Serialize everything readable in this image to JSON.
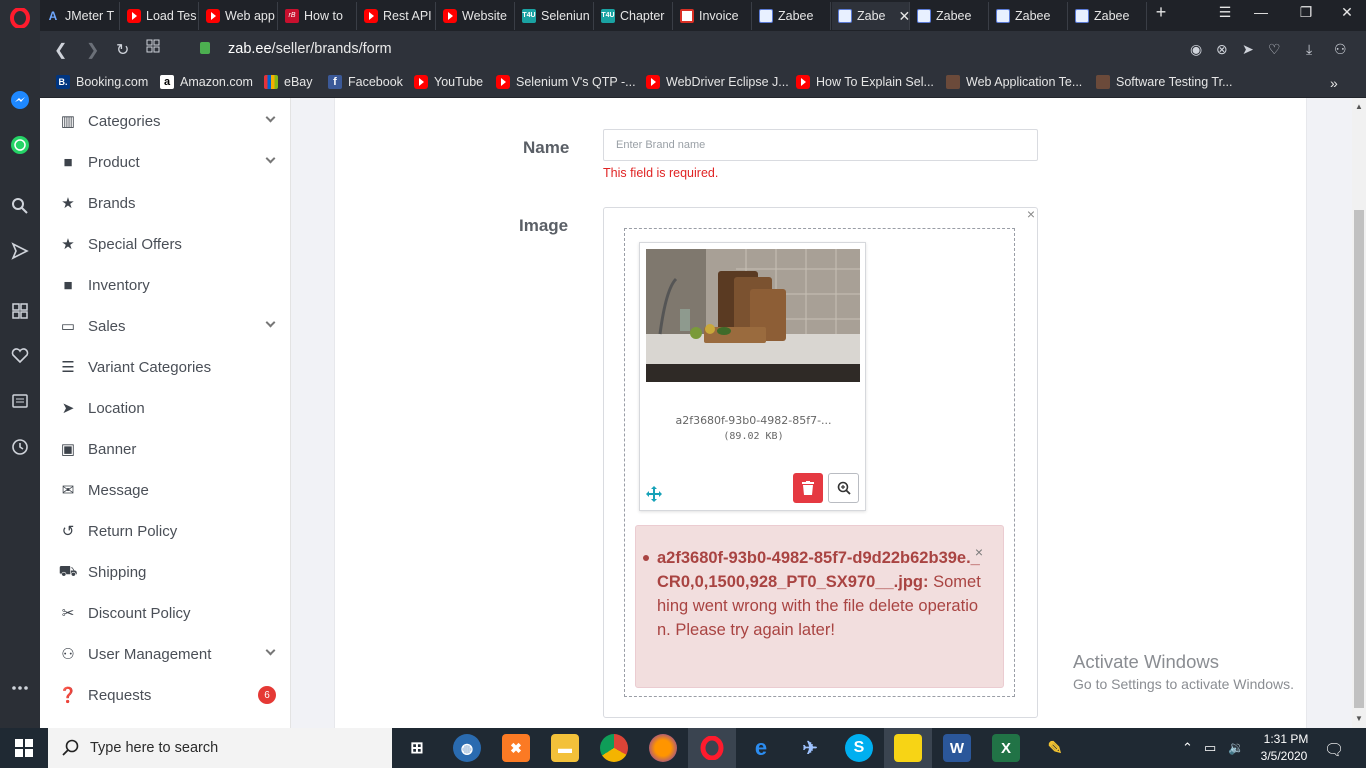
{
  "browser": {
    "tabs": [
      {
        "label": "JMeter T",
        "icon": "jmeter-icon"
      },
      {
        "label": "Load Tes",
        "icon": "youtube-icon"
      },
      {
        "label": "Web app",
        "icon": "youtube-icon"
      },
      {
        "label": "How to",
        "icon": "redbus-icon"
      },
      {
        "label": "Rest API",
        "icon": "youtube-icon"
      },
      {
        "label": "Website",
        "icon": "youtube-icon"
      },
      {
        "label": "Seleniun",
        "icon": "t4u-icon"
      },
      {
        "label": "Chapter",
        "icon": "t4u-icon"
      },
      {
        "label": "Invoice",
        "icon": "gmail-icon"
      },
      {
        "label": "Zabee",
        "icon": "zabee-icon"
      },
      {
        "label": "Zabe",
        "icon": "zabee-icon",
        "active": true
      },
      {
        "label": "Zabee",
        "icon": "zabee-icon"
      },
      {
        "label": "Zabee",
        "icon": "zabee-icon"
      },
      {
        "label": "Zabee",
        "icon": "zabee-icon"
      }
    ],
    "url_host": "zab.ee",
    "url_path": "/seller/brands/form",
    "t4u_text": "T4U",
    "redbus_text": "rB",
    "jmeter_text": "A",
    "bookmarks": [
      {
        "label": "Booking.com",
        "icon": "booking-icon"
      },
      {
        "label": "Amazon.com",
        "icon": "amazon-icon"
      },
      {
        "label": "eBay",
        "icon": "ebay-icon"
      },
      {
        "label": "Facebook",
        "icon": "facebook-icon"
      },
      {
        "label": "YouTube",
        "icon": "youtube-icon"
      },
      {
        "label": "Selenium V's QTP -...",
        "icon": "youtube-icon"
      },
      {
        "label": "WebDriver Eclipse J...",
        "icon": "youtube-icon"
      },
      {
        "label": "How To Explain Sel...",
        "icon": "youtube-icon"
      },
      {
        "label": "Web Application Te...",
        "icon": "cube-icon"
      },
      {
        "label": "Software Testing Tr...",
        "icon": "cube-icon"
      }
    ],
    "booking_text": "B.",
    "amazon_text": "a",
    "facebook_text": "f"
  },
  "sidebar": {
    "items": [
      {
        "label": "Categories",
        "icon": "bar-chart-icon",
        "expandable": true
      },
      {
        "label": "Product",
        "icon": "briefcase-icon",
        "expandable": true
      },
      {
        "label": "Brands",
        "icon": "star-icon"
      },
      {
        "label": "Special Offers",
        "icon": "star-icon"
      },
      {
        "label": "Inventory",
        "icon": "briefcase-icon"
      },
      {
        "label": "Sales",
        "icon": "money-icon",
        "expandable": true
      },
      {
        "label": "Variant Categories",
        "icon": "list-icon"
      },
      {
        "label": "Location",
        "icon": "location-arrow-icon"
      },
      {
        "label": "Banner",
        "icon": "image-icon"
      },
      {
        "label": "Message",
        "icon": "envelope-icon"
      },
      {
        "label": "Return Policy",
        "icon": "undo-icon"
      },
      {
        "label": "Shipping",
        "icon": "truck-icon"
      },
      {
        "label": "Discount Policy",
        "icon": "scissors-icon"
      },
      {
        "label": "User Management",
        "icon": "users-icon",
        "expandable": true
      },
      {
        "label": "Requests",
        "icon": "question-icon",
        "badge": "6"
      }
    ]
  },
  "form": {
    "name_label": "Name",
    "name_placeholder": "Enter Brand name",
    "name_value": "",
    "name_error": "This field is required.",
    "image_label": "Image",
    "file": {
      "name": "a2f3680f-93b0-4982-85f7-...",
      "size": "(89.02 KB)"
    },
    "alert": {
      "file": "a2f3680f-93b0-4982-85f7-d9d22b62b39e._CR0,0,1500,928_PT0_SX970__.jpg:",
      "message": "Something went wrong with the file delete operation. Please try again later!",
      "close": "×"
    },
    "box_close": "×"
  },
  "watermark": {
    "line1": "Activate Windows",
    "line2": "Go to Settings to activate Windows."
  },
  "taskbar": {
    "search_placeholder": "Type here to search",
    "time": "1:31 PM",
    "date": "3/5/2020"
  },
  "colors": {
    "accent_red": "#e53941",
    "error_red": "#e02424",
    "alert_bg": "#f2dede",
    "alert_text": "#a94442",
    "move_handle": "#17a2b8"
  }
}
